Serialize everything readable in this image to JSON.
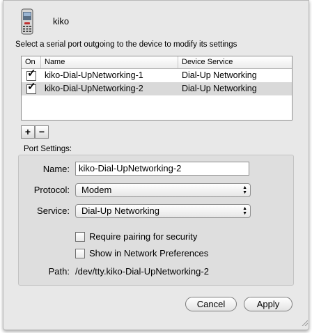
{
  "device": {
    "name": "kiko",
    "icon": "mobile-phone-icon"
  },
  "instructions": "Select a serial port outgoing to the device to modify its settings",
  "table": {
    "columns": [
      "On",
      "Name",
      "Device Service"
    ],
    "rows": [
      {
        "on": "✓",
        "name": "kiko-Dial-UpNetworking-1",
        "service": "Dial-Up Networking",
        "selected": false
      },
      {
        "on": "✓",
        "name": "kiko-Dial-UpNetworking-2",
        "service": "Dial-Up Networking",
        "selected": true
      }
    ]
  },
  "buttons": {
    "add": "+",
    "remove": "−",
    "cancel": "Cancel",
    "apply": "Apply"
  },
  "port_settings": {
    "title": "Port Settings:",
    "name_label": "Name:",
    "name_value": "kiko-Dial-UpNetworking-2",
    "protocol_label": "Protocol:",
    "protocol_value": "Modem",
    "service_label": "Service:",
    "service_value": "Dial-Up Networking",
    "require_pairing": "Require pairing for security",
    "show_in_network": "Show in Network Preferences",
    "path_label": "Path:",
    "path_value": "/dev/tty.kiko-Dial-UpNetworking-2"
  },
  "colors": {
    "window_bg": "#e8e8e8",
    "selected_row": "#d9d9d9"
  }
}
